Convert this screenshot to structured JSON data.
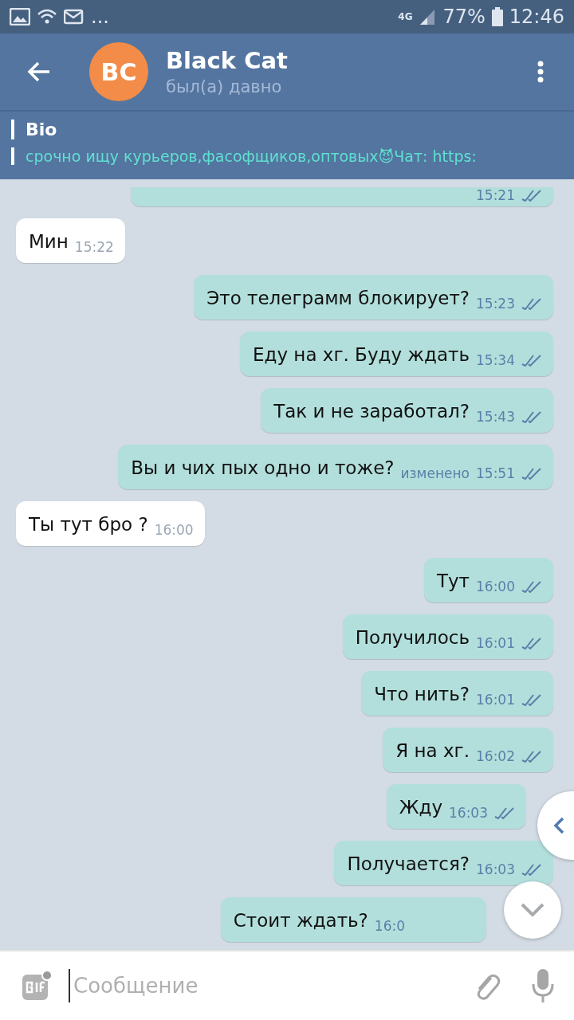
{
  "status_bar": {
    "more": "...",
    "network": "4G",
    "battery": "77%",
    "time": "12:46"
  },
  "header": {
    "avatar_initials": "BC",
    "name": "Black Cat",
    "last_seen": "был(а) давно"
  },
  "bio": {
    "label": "Bio",
    "text": "срочно ищу курьеров,фасофщиков,оптовых😈Чат: https:"
  },
  "messages": [
    {
      "kind": "outgoing",
      "time": "15:21",
      "read": true
    },
    {
      "kind": "incoming",
      "text": "Мин",
      "time": "15:22",
      "read": false
    },
    {
      "kind": "outgoing",
      "text": "Это телеграмм блокирует?",
      "time": "15:23",
      "read": true
    },
    {
      "kind": "outgoing",
      "text": "Еду на хг. Буду ждать",
      "time": "15:34",
      "read": true
    },
    {
      "kind": "outgoing",
      "text": "Так и не заработал?",
      "time": "15:43",
      "read": true
    },
    {
      "kind": "outgoing",
      "text": "Вы и чих пых одно и тоже?",
      "time": "15:51",
      "read": true,
      "edited": "изменено"
    },
    {
      "kind": "incoming",
      "text": "Ты тут бро ?",
      "time": "16:00",
      "read": false
    },
    {
      "kind": "outgoing",
      "text": "Тут",
      "time": "16:00",
      "read": true
    },
    {
      "kind": "outgoing",
      "text": "Получилось",
      "time": "16:01",
      "read": true
    },
    {
      "kind": "outgoing",
      "text": "Что нить?",
      "time": "16:01",
      "read": true
    },
    {
      "kind": "outgoing",
      "text": "Я на хг.",
      "time": "16:02",
      "read": true
    },
    {
      "kind": "outgoing",
      "text": "Жду",
      "time": "16:03",
      "read": true
    },
    {
      "kind": "outgoing",
      "text": "Получается?",
      "time": "16:03",
      "read": true
    },
    {
      "kind": "outgoing",
      "text": "Стоит ждать?",
      "time": "16:0",
      "read": false
    }
  ],
  "composer": {
    "placeholder": "Сообщение"
  }
}
